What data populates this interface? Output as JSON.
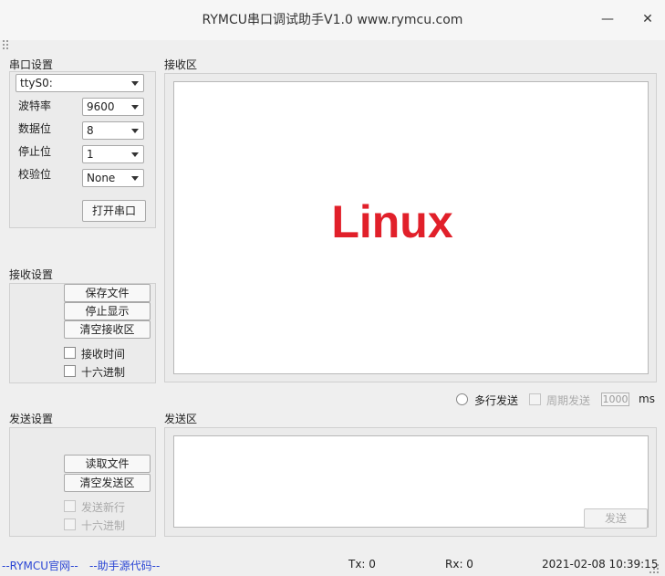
{
  "window": {
    "title": "RYMCU串口调试助手V1.0 www.rymcu.com",
    "minimize": "—",
    "close": "✕"
  },
  "serial_settings": {
    "label": "串口设置",
    "port_value": "ttyS0:",
    "baud_label": "波特率",
    "baud_value": "9600",
    "databits_label": "数据位",
    "databits_value": "8",
    "stopbits_label": "停止位",
    "stopbits_value": "1",
    "parity_label": "校验位",
    "parity_value": "None",
    "open_button": "打开串口"
  },
  "receive_settings": {
    "label": "接收设置",
    "save_file": "保存文件",
    "stop_display": "停止显示",
    "clear_receive": "清空接收区",
    "receive_time": "接收时间",
    "hex": "十六进制"
  },
  "receive_area": {
    "label": "接收区",
    "overlay_text": "Linux",
    "overlay_color": "#e1202a"
  },
  "send_options": {
    "multiline": "多行发送",
    "periodic": "周期发送",
    "period_value": "1000",
    "unit": "ms"
  },
  "send_settings": {
    "label": "发送设置",
    "read_file": "读取文件",
    "clear_send": "清空发送区",
    "send_newline": "发送新行",
    "hex": "十六进制"
  },
  "send_area": {
    "label": "发送区",
    "send_button": "发送"
  },
  "status_bar": {
    "official_site": "--RYMCU官网--",
    "source_code": "--助手源代码--",
    "tx": "Tx: 0",
    "rx": "Rx: 0",
    "datetime": "2021-02-08 10:39:15"
  }
}
